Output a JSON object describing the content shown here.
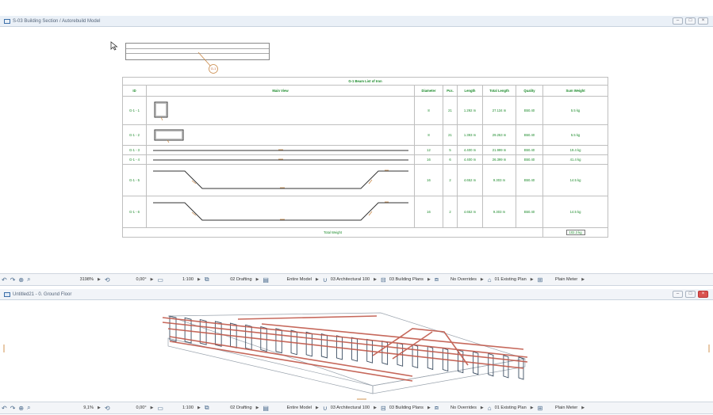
{
  "top_window": {
    "title": "S-03 Building Section / Autorebuild Model",
    "elevation_marker": "G-1",
    "table": {
      "title": "G-1 Beam List of Iron",
      "headers": [
        "ID",
        "Main View",
        "Diameter",
        "Pcs.",
        "Length",
        "Total Length",
        "Quality",
        "Sum Weight"
      ],
      "rows": [
        {
          "id": "G-1 - 1",
          "diameter": "8",
          "pcs": "21",
          "length": "1.292 m",
          "total_length": "27.134 m",
          "quality": "B50.40",
          "sum_weight": "5.5 kg"
        },
        {
          "id": "G-1 - 2",
          "diameter": "8",
          "pcs": "21",
          "length": "1.393 m",
          "total_length": "29.253 m",
          "quality": "B50.40",
          "sum_weight": "5.5 kg"
        },
        {
          "id": "G-1 - 3",
          "diameter": "12",
          "pcs": "5",
          "length": "4.400 m",
          "total_length": "21.999 m",
          "quality": "B50.40",
          "sum_weight": "19.4 kg"
        },
        {
          "id": "G-1 - 4",
          "diameter": "16",
          "pcs": "6",
          "length": "4.400 m",
          "total_length": "26.399 m",
          "quality": "B50.40",
          "sum_weight": "41.4 kg"
        },
        {
          "id": "G-1 - 5",
          "diameter": "16",
          "pcs": "2",
          "length": "4.652 m",
          "total_length": "9.303 m",
          "quality": "B50.40",
          "sum_weight": "14.5 kg"
        },
        {
          "id": "G-1 - 6",
          "diameter": "16",
          "pcs": "2",
          "length": "4.652 m",
          "total_length": "9.303 m",
          "quality": "B50.40",
          "sum_weight": "14.5 kg"
        }
      ],
      "total_label": "Total Weight",
      "total_value": "102.3 kg"
    },
    "status": {
      "zoom": "3198%",
      "angle": "0,00°",
      "scale": "1:100",
      "layer_combo": "02 Drafting",
      "model_view": "Entire Model",
      "pen_set": "03 Architectural 100",
      "dimension": "03 Building Plans",
      "overrides": "No Overrides",
      "renovation": "01 Existing Plan",
      "units": "Plain Meter"
    }
  },
  "bottom_window": {
    "title": "Untitled21 - 0. Ground Floor",
    "status": {
      "zoom": "9,1%",
      "angle": "0,00°",
      "scale": "1:100",
      "layer_combo": "02 Drafting",
      "model_view": "Entire Model",
      "pen_set": "03 Architectural 100",
      "dimension": "03 Building Plans",
      "overrides": "No Overrides",
      "renovation": "01 Existing Plan",
      "units": "Plain Meter"
    }
  },
  "icons": {
    "window": "window-icon",
    "floor": "floor-icon",
    "cursor": "cursor-icon"
  },
  "colors": {
    "table_text": "#1b8a2a",
    "rebar": "#c0584a",
    "stirrup": "#3d4f63",
    "accent": "#3b6ea8"
  }
}
